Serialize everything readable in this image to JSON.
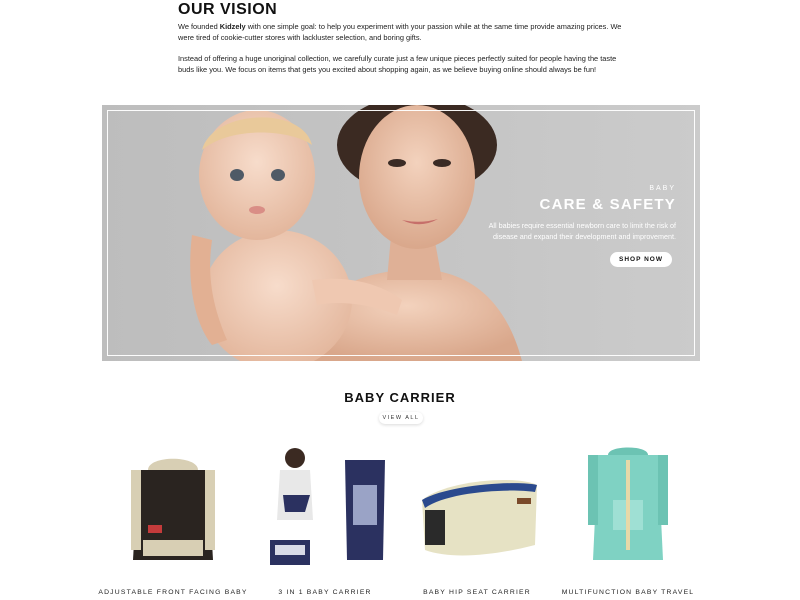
{
  "vision": {
    "heading": "OUR VISION",
    "p1_pre": "We founded ",
    "p1_brand": "Kidzely",
    "p1_post": " with one simple goal: to help you experiment with your passion while at the same time provide amazing prices. We were tired of cookie-cutter stores with lackluster selection, and boring gifts.",
    "p2": "Instead of offering a huge unoriginal collection, we carefully curate just a few unique pieces perfectly suited for people having the taste buds like you. We focus on items that gets you excited about shopping again, as we believe buying online should always be fun!"
  },
  "banner": {
    "kicker": "BABY",
    "title": "CARE & SAFETY",
    "description": "All babies require essential newborn care to limit the risk of disease and expand their development and improvement.",
    "button_label": "SHOP NOW"
  },
  "section": {
    "title": "BABY CARRIER",
    "view_all_label": "VIEW ALL"
  },
  "products": [
    {
      "title": "ADJUSTABLE FRONT FACING BABY"
    },
    {
      "title": "3 IN 1 BABY CARRIER"
    },
    {
      "title": "BABY HIP SEAT CARRIER"
    },
    {
      "title": "MULTIFUNCTION BABY TRAVEL"
    }
  ],
  "colors": {
    "banner_bg": "#c4c4c4",
    "text_dark": "#111111",
    "carrier_black": "#2a2420",
    "carrier_cream": "#d8cfb4",
    "carrier_navy": "#2b3160",
    "hipseat_beige": "#e6e2c4",
    "carrier_mint": "#7fd2c3"
  }
}
